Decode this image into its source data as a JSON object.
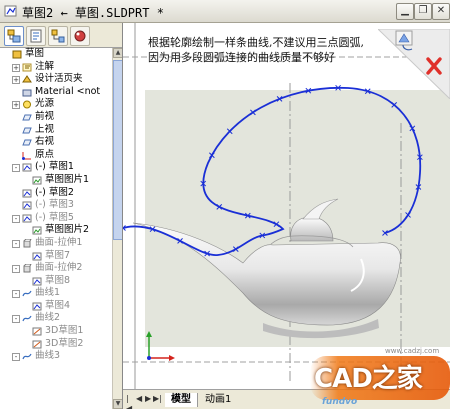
{
  "window": {
    "title": "草图2 ← 草图.SLDPRT *",
    "buttons": [
      "minimize",
      "restore",
      "close"
    ]
  },
  "feature_tabs": [
    "feature-manager-icon",
    "property-manager-icon",
    "configuration-manager-icon",
    "display-manager-icon"
  ],
  "tree": [
    {
      "label": "草图",
      "level": 0,
      "icon": "part-icon",
      "dim": false,
      "exp": ""
    },
    {
      "label": "注解",
      "level": 1,
      "icon": "annotation-icon",
      "dim": false,
      "exp": "+"
    },
    {
      "label": "设计活页夹",
      "level": 1,
      "icon": "binder-icon",
      "dim": false,
      "exp": "+"
    },
    {
      "label": "Material <not",
      "level": 1,
      "icon": "material-icon",
      "dim": false,
      "exp": ""
    },
    {
      "label": "光源",
      "level": 1,
      "icon": "light-icon",
      "dim": false,
      "exp": "+"
    },
    {
      "label": "前视",
      "level": 1,
      "icon": "plane-icon",
      "dim": false,
      "exp": ""
    },
    {
      "label": "上视",
      "level": 1,
      "icon": "plane-icon",
      "dim": false,
      "exp": ""
    },
    {
      "label": "右视",
      "level": 1,
      "icon": "plane-icon",
      "dim": false,
      "exp": ""
    },
    {
      "label": "原点",
      "level": 1,
      "icon": "origin-icon",
      "dim": false,
      "exp": ""
    },
    {
      "label": "(-) 草图1",
      "level": 1,
      "icon": "sketch-icon",
      "dim": false,
      "exp": "-"
    },
    {
      "label": "草图图片1",
      "level": 2,
      "icon": "picture-icon",
      "dim": false,
      "exp": ""
    },
    {
      "label": "(-) 草图2",
      "level": 1,
      "icon": "sketch-icon",
      "dim": false,
      "exp": ""
    },
    {
      "label": "(-) 草图3",
      "level": 1,
      "icon": "sketch-icon",
      "dim": true,
      "exp": ""
    },
    {
      "label": "(-) 草图5",
      "level": 1,
      "icon": "sketch-icon",
      "dim": true,
      "exp": "-"
    },
    {
      "label": "草图图片2",
      "level": 2,
      "icon": "picture-icon",
      "dim": false,
      "exp": ""
    },
    {
      "label": "曲面-拉伸1",
      "level": 1,
      "icon": "extrude-icon",
      "dim": true,
      "exp": "-"
    },
    {
      "label": "草图7",
      "level": 2,
      "icon": "sketch-icon",
      "dim": true,
      "exp": ""
    },
    {
      "label": "曲面-拉伸2",
      "level": 1,
      "icon": "extrude-icon",
      "dim": true,
      "exp": "-"
    },
    {
      "label": "草图8",
      "level": 2,
      "icon": "sketch-icon",
      "dim": true,
      "exp": ""
    },
    {
      "label": "曲线1",
      "level": 1,
      "icon": "curve-icon",
      "dim": true,
      "exp": "-"
    },
    {
      "label": "草图4",
      "level": 2,
      "icon": "sketch-icon",
      "dim": true,
      "exp": ""
    },
    {
      "label": "曲线2",
      "level": 1,
      "icon": "curve-icon",
      "dim": true,
      "exp": "-"
    },
    {
      "label": "3D草图1",
      "level": 2,
      "icon": "sketch3d-icon",
      "dim": true,
      "exp": ""
    },
    {
      "label": "3D草图2",
      "level": 2,
      "icon": "sketch3d-icon",
      "dim": true,
      "exp": ""
    },
    {
      "label": "曲线3",
      "level": 1,
      "icon": "curve-icon",
      "dim": true,
      "exp": "-"
    }
  ],
  "canvas": {
    "note": "根据轮廓绘制一样条曲线,不建议用三点圆弧,因为用多段圆弧连接的曲线质量不够好",
    "confirm_corner": [
      "rebuild-icon",
      "cancel-icon"
    ]
  },
  "bottom_tabs": {
    "model": "模型",
    "motion": "动画1"
  },
  "watermark": {
    "brand": "CAD之家",
    "site": "www.cadzj.com",
    "logo": "fundvo"
  },
  "colors": {
    "spline": "#1a2fd6",
    "picture_bg": "#e3e5dc",
    "cancel_x": "#e0302a"
  }
}
